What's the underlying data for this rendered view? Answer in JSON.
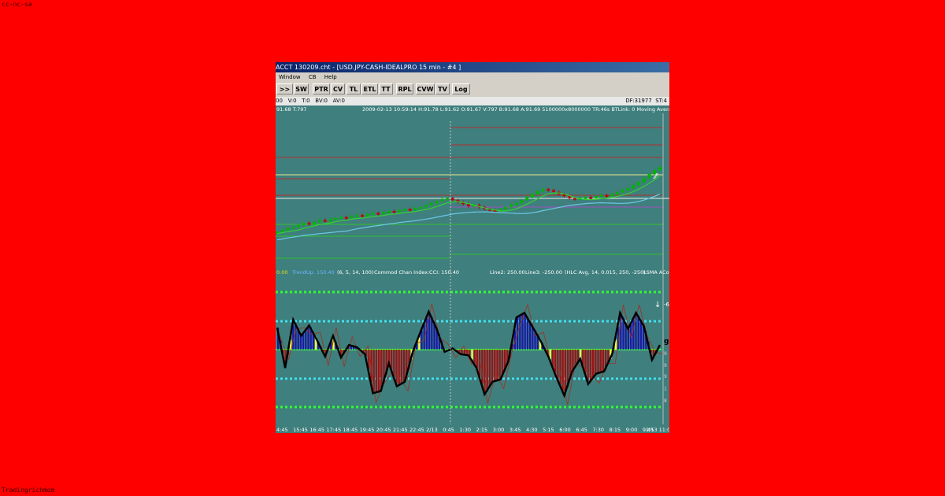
{
  "watermark_top": "cc-nc-sa",
  "watermark_bottom": "Tradingrichmom",
  "window": {
    "title": "ACCT 130209.cht - [USD.JPY-CASH-IDEALPRO  15 min  - #4 ]",
    "menu": [
      "Window",
      "CB",
      "Help"
    ],
    "toolbar": [
      ">><<",
      "SW",
      "PTR",
      "CV",
      "TL",
      "ETL",
      "TT",
      "RPL",
      "CVW",
      "TV",
      "Log"
    ]
  },
  "status": {
    "left": "00   V:0   T:0   BV:0   AV:0",
    "df": "DF:31977",
    "st": "ST:4"
  },
  "price_info": {
    "last": "91.68  T:797",
    "details": "2009-02-13  10:59:14  H:91.78  L:91.62  O:91.67  V:797  B:91.68  A:91.69  5100000x8000000   TR:46s  BTLink:  0   Moving Averag"
  },
  "indicator_info": {
    "val0": "0.00",
    "trend_up": "TrendUp: 150.40",
    "params": "(6, 5, 14, 100)",
    "cci_label": "Commod Chan Index:",
    "cci_value": "CCI: 150.40",
    "line2": "Line2: 250.00",
    "line3": "Line3: -250.00",
    "hlc": "(HLC Avg, 14, 0.015, 250, -250)",
    "lsma": "LSMA ACov"
  },
  "right_scale": [
    "-6",
    "g",
    "9",
    "9",
    "9",
    "1",
    "8"
  ],
  "time_axis": [
    "4:45",
    "15:45",
    "16:45",
    "17:45",
    "18:45",
    "19:45",
    "20:45",
    "21:45",
    "22:45",
    "2/13",
    "0:45",
    "1:30",
    "2:15",
    "3:00",
    "3:45",
    "4:30",
    "5:15",
    "6:00",
    "6:45",
    "7:30",
    "8:15",
    "9:00",
    "9:45",
    "2/13 11:0"
  ],
  "colors": {
    "background": "#ff0000",
    "chart_bg": "#3f7f7d",
    "bull_candle": "#00b400",
    "bear_candle": "#c00000",
    "ma_green": "#33d133",
    "ma_blue": "#6cc8e8",
    "cci_line": "#000000",
    "histogram_blue": "#1a1aa8",
    "histogram_red": "#a01010",
    "histogram_yellow": "#ffff40",
    "zero_line": "#40ff40",
    "dotted_cyan": "#40e0f0",
    "dotted_green": "#30ff30"
  },
  "chart_data": {
    "type": "line",
    "candle_closes": [
      89.62,
      89.66,
      89.7,
      89.72,
      89.76,
      89.8,
      89.78,
      89.82,
      89.86,
      89.84,
      89.88,
      89.9,
      89.92,
      89.9,
      89.94,
      89.96,
      89.94,
      89.98,
      90.0,
      89.98,
      90.02,
      90.04,
      90.02,
      90.06,
      90.08,
      90.06,
      90.1,
      90.12,
      90.16,
      90.2,
      90.24,
      90.28,
      90.3,
      90.26,
      90.22,
      90.18,
      90.14,
      90.16,
      90.12,
      90.08,
      90.06,
      90.04,
      90.08,
      90.12,
      90.16,
      90.2,
      90.26,
      90.32,
      90.38,
      90.44,
      90.48,
      90.46,
      90.42,
      90.38,
      90.34,
      90.3,
      90.28,
      90.3,
      90.32,
      90.3,
      90.34,
      90.36,
      90.34,
      90.38,
      90.42,
      90.46,
      90.5,
      90.56,
      90.62,
      90.7,
      90.78,
      90.86,
      90.92
    ],
    "cci_values": [
      95,
      -80,
      130,
      60,
      105,
      40,
      -30,
      60,
      -35,
      20,
      10,
      -20,
      -190,
      -180,
      -60,
      -160,
      -140,
      -10,
      80,
      165,
      90,
      -10,
      5,
      -20,
      -25,
      -80,
      -195,
      -140,
      -130,
      -50,
      140,
      160,
      100,
      40,
      -30,
      -120,
      -200,
      -95,
      -40,
      -150,
      -105,
      -95,
      -20,
      160,
      90,
      160,
      100,
      -45,
      20
    ],
    "cci_lines": {
      "line1": 250,
      "line2": 250,
      "zero": 0,
      "line3": -250,
      "line4": -500
    }
  }
}
